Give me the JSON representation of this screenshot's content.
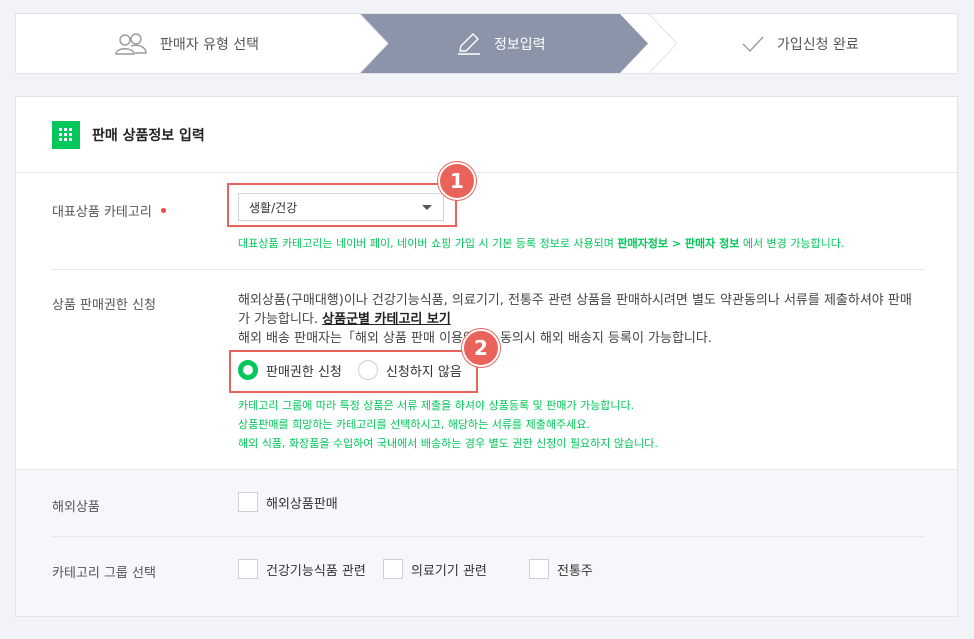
{
  "stepper": {
    "steps": [
      {
        "label": "판매자 유형 선택",
        "icon": "users-icon"
      },
      {
        "label": "정보입력",
        "icon": "pencil-icon"
      },
      {
        "label": "가입신청 완료",
        "icon": "check-icon"
      }
    ],
    "active_color": "#8b94a8"
  },
  "card": {
    "title": "판매 상품정보 입력",
    "accent": "#03c75a"
  },
  "category": {
    "label": "대표상품 카테고리",
    "selected": "생활/건강",
    "note_prefix": "대표상품 카테고리는 네이버 페이, 네이버 쇼핑 가입 시 기본 등록 정보로 사용되며 ",
    "note_bold": "판매자정보 > 판매자 정보",
    "note_suffix": " 에서 변경 가능합니다."
  },
  "permission": {
    "label": "상품 판매권한 신청",
    "desc_line1": "해외상품(구매대행)이나 건강기능식품, 의료기기, 전통주 관련 상품을 판매하시려면 별도 약관동의나 서류를 제출하셔야 판매",
    "desc_line2_prefix": "가 가능합니다. ",
    "desc_link": "상품군별 카테고리 보기",
    "desc_line3": "해외 배송 판매자는「해외 상품 판매 이용약관」동의시 해외 배송지 등록이 가능합니다.",
    "options": [
      "판매권한 신청",
      "신청하지 않음"
    ],
    "selected_index": 0,
    "notes": [
      "카테고리 그룹에 따라 특정 상품은 서류 제출을 하셔야 상품등록 및 판매가 가능합니다.",
      "상품판매를 희망하는 카테고리를 선택하시고, 해당하는 서류를 제출해주세요.",
      "해외 식품, 화장품을 수입하여 국내에서 배송하는 경우 별도 권한 신청이 필요하지 않습니다."
    ]
  },
  "overseas": {
    "label": "해외상품",
    "checkbox": "해외상품판매"
  },
  "category_group": {
    "label": "카테고리 그룹 선택",
    "checkboxes": [
      "건강기능식품 관련",
      "의료기기 관련",
      "전통주"
    ]
  },
  "annotations": {
    "badge1": "1",
    "badge2": "2",
    "color": "#e9635a"
  }
}
